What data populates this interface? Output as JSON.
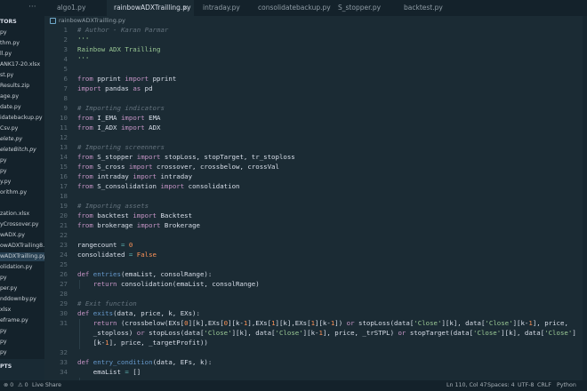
{
  "tabs": [
    {
      "label": "algo1.py",
      "active": false
    },
    {
      "label": "rainbowADXTrailling.py",
      "active": true
    },
    {
      "label": "intraday.py",
      "active": false
    },
    {
      "label": "consolidatebackup.py",
      "active": false
    },
    {
      "label": "S_stopper.py",
      "active": false
    },
    {
      "label": "backtest.py",
      "active": false
    }
  ],
  "tab_overflow": "···",
  "close_glyph": "×",
  "sidebar": {
    "section_title": "TORS",
    "files": [
      {
        "label": "py",
        "style": ""
      },
      {
        "label": "thm.py",
        "style": ""
      },
      {
        "label": "ll.py",
        "style": ""
      },
      {
        "label": "ANK17-20.xlsx",
        "style": ""
      },
      {
        "label": "st.py",
        "style": ""
      },
      {
        "label": "Results.zip",
        "style": ""
      },
      {
        "label": "age.py",
        "style": ""
      },
      {
        "label": "date.py",
        "style": ""
      },
      {
        "label": "idatebackup.py",
        "style": ""
      },
      {
        "label": "Csv.py",
        "style": ""
      },
      {
        "label": "elete.py",
        "style": "ital"
      },
      {
        "label": "eleteBitch.py",
        "style": "ital"
      },
      {
        "label": "py",
        "style": ""
      },
      {
        "label": "py",
        "style": ""
      },
      {
        "label": "y.py",
        "style": ""
      },
      {
        "label": "orithm.py",
        "style": ""
      },
      {
        "label": "",
        "style": ""
      },
      {
        "label": "zation.xlsx",
        "style": ""
      },
      {
        "label": "yCrossover.py",
        "style": ""
      },
      {
        "label": "wADX.py",
        "style": ""
      },
      {
        "label": "owADXTrailing8...",
        "style": ""
      },
      {
        "label": "wADXTrailling.py",
        "style": "sel"
      },
      {
        "label": "olidation.py",
        "style": ""
      },
      {
        "label": "py",
        "style": ""
      },
      {
        "label": "per.py",
        "style": ""
      },
      {
        "label": "nddownby.py",
        "style": ""
      },
      {
        "label": "xlsx",
        "style": ""
      },
      {
        "label": "eframe.py",
        "style": ""
      },
      {
        "label": "py",
        "style": ""
      },
      {
        "label": "py",
        "style": ""
      },
      {
        "label": "py",
        "style": ""
      }
    ],
    "footer_title": "PTS"
  },
  "editor": {
    "breadcrumb": "rainbowADXTrailling.py",
    "lines": [
      {
        "n": "1",
        "tokens": [
          [
            "c-cmt",
            "# Author - Karan Parmar"
          ]
        ]
      },
      {
        "n": "2",
        "tokens": [
          [
            "c-str",
            "'''"
          ]
        ]
      },
      {
        "n": "3",
        "tokens": [
          [
            "c-str",
            "Rainbow ADX Trailling"
          ]
        ]
      },
      {
        "n": "4",
        "tokens": [
          [
            "c-str",
            "'''"
          ]
        ]
      },
      {
        "n": "5",
        "tokens": []
      },
      {
        "n": "6",
        "tokens": [
          [
            "c-kw",
            "from"
          ],
          [
            "c-id",
            " pprint "
          ],
          [
            "c-kw",
            "import"
          ],
          [
            "c-id",
            " pprint"
          ]
        ]
      },
      {
        "n": "7",
        "tokens": [
          [
            "c-kw",
            "import"
          ],
          [
            "c-id",
            " pandas "
          ],
          [
            "c-kw",
            "as"
          ],
          [
            "c-id",
            " pd"
          ]
        ]
      },
      {
        "n": "8",
        "tokens": []
      },
      {
        "n": "9",
        "tokens": [
          [
            "c-cmt",
            "# Importing indicators"
          ]
        ]
      },
      {
        "n": "10",
        "tokens": [
          [
            "c-kw",
            "from"
          ],
          [
            "c-id",
            " I_EMA "
          ],
          [
            "c-kw",
            "import"
          ],
          [
            "c-id",
            " EMA"
          ]
        ]
      },
      {
        "n": "11",
        "tokens": [
          [
            "c-kw",
            "from"
          ],
          [
            "c-id",
            " I_ADX "
          ],
          [
            "c-kw",
            "import"
          ],
          [
            "c-id",
            " ADX"
          ]
        ]
      },
      {
        "n": "12",
        "tokens": []
      },
      {
        "n": "13",
        "tokens": [
          [
            "c-cmt",
            "# Importing screenners"
          ]
        ]
      },
      {
        "n": "14",
        "tokens": [
          [
            "c-kw",
            "from"
          ],
          [
            "c-id",
            " S_stopper "
          ],
          [
            "c-kw",
            "import"
          ],
          [
            "c-id",
            " stopLoss, stopTarget, tr_stoploss"
          ]
        ]
      },
      {
        "n": "15",
        "tokens": [
          [
            "c-kw",
            "from"
          ],
          [
            "c-id",
            " S_cross "
          ],
          [
            "c-kw",
            "import"
          ],
          [
            "c-id",
            " crossover, crossbelow, crossVal"
          ]
        ]
      },
      {
        "n": "16",
        "tokens": [
          [
            "c-kw",
            "from"
          ],
          [
            "c-id",
            " intraday "
          ],
          [
            "c-kw",
            "import"
          ],
          [
            "c-id",
            " intraday"
          ]
        ]
      },
      {
        "n": "17",
        "tokens": [
          [
            "c-kw",
            "from"
          ],
          [
            "c-id",
            " S_consolidation "
          ],
          [
            "c-kw",
            "import"
          ],
          [
            "c-id",
            " consolidation"
          ]
        ]
      },
      {
        "n": "18",
        "tokens": []
      },
      {
        "n": "19",
        "tokens": [
          [
            "c-cmt",
            "# Importing assets"
          ]
        ]
      },
      {
        "n": "20",
        "tokens": [
          [
            "c-kw",
            "from"
          ],
          [
            "c-id",
            " backtest "
          ],
          [
            "c-kw",
            "import"
          ],
          [
            "c-id",
            " Backtest"
          ]
        ]
      },
      {
        "n": "21",
        "tokens": [
          [
            "c-kw",
            "from"
          ],
          [
            "c-id",
            " brokerage "
          ],
          [
            "c-kw",
            "import"
          ],
          [
            "c-id",
            " Brokerage"
          ]
        ]
      },
      {
        "n": "22",
        "tokens": []
      },
      {
        "n": "23",
        "tokens": [
          [
            "c-id",
            "rangecount "
          ],
          [
            "c-op",
            "="
          ],
          [
            "c-num",
            " 0"
          ]
        ]
      },
      {
        "n": "24",
        "tokens": [
          [
            "c-id",
            "consolidated "
          ],
          [
            "c-op",
            "="
          ],
          [
            "c-num",
            " False"
          ]
        ]
      },
      {
        "n": "25",
        "tokens": []
      },
      {
        "n": "26",
        "tokens": [
          [
            "c-kw",
            "def"
          ],
          [
            "c-fn",
            " entries"
          ],
          [
            "c-id",
            "(emaList, consolRange):"
          ]
        ]
      },
      {
        "n": "27",
        "tokens": [
          [
            "c-kw",
            "    return"
          ],
          [
            "c-id",
            " consolidation(emaList, consolRange)"
          ]
        ]
      },
      {
        "n": "28",
        "tokens": []
      },
      {
        "n": "29",
        "tokens": [
          [
            "c-cmt",
            "# Exit function"
          ]
        ]
      },
      {
        "n": "30",
        "tokens": [
          [
            "c-kw",
            "def"
          ],
          [
            "c-fn",
            " exits"
          ],
          [
            "c-id",
            "(data, price, k, EXs):"
          ]
        ]
      },
      {
        "n": "31",
        "tokens": [
          [
            "c-kw",
            "    return"
          ],
          [
            "c-id",
            " (crossbelow(EXs["
          ],
          [
            "c-num",
            "0"
          ],
          [
            "c-id",
            "][k],EXs["
          ],
          [
            "c-num",
            "0"
          ],
          [
            "c-id",
            "][k-"
          ],
          [
            "c-num",
            "1"
          ],
          [
            "c-id",
            "],EXs["
          ],
          [
            "c-num",
            "1"
          ],
          [
            "c-id",
            "][k],EXs["
          ],
          [
            "c-num",
            "1"
          ],
          [
            "c-id",
            "][k-"
          ],
          [
            "c-num",
            "1"
          ],
          [
            "c-id",
            "]) "
          ],
          [
            "c-kw",
            "or"
          ],
          [
            "c-id",
            " stopLoss(data["
          ],
          [
            "c-str",
            "'Close'"
          ],
          [
            "c-id",
            "][k], data["
          ],
          [
            "c-str",
            "'Close'"
          ],
          [
            "c-id",
            "][k-"
          ],
          [
            "c-num",
            "1"
          ],
          [
            "c-id",
            "], price,"
          ]
        ]
      },
      {
        "n": "",
        "tokens": [
          [
            "c-id",
            "    _stoploss) "
          ],
          [
            "c-kw",
            "or"
          ],
          [
            "c-id",
            " stopLoss(data["
          ],
          [
            "c-str",
            "'Close'"
          ],
          [
            "c-id",
            "][k], data["
          ],
          [
            "c-str",
            "'Close'"
          ],
          [
            "c-id",
            "][k-"
          ],
          [
            "c-num",
            "1"
          ],
          [
            "c-id",
            "], price, _trSTPL) "
          ],
          [
            "c-kw",
            "or"
          ],
          [
            "c-id",
            " stopTarget(data["
          ],
          [
            "c-str",
            "'Close'"
          ],
          [
            "c-id",
            "][k], data["
          ],
          [
            "c-str",
            "'Close'"
          ],
          [
            "c-id",
            "]"
          ]
        ]
      },
      {
        "n": "",
        "tokens": [
          [
            "c-id",
            "    [k-"
          ],
          [
            "c-num",
            "1"
          ],
          [
            "c-id",
            "], price, _targetProfit))"
          ]
        ]
      },
      {
        "n": "32",
        "tokens": []
      },
      {
        "n": "33",
        "tokens": [
          [
            "c-kw",
            "def"
          ],
          [
            "c-fn",
            " entry_condition"
          ],
          [
            "c-id",
            "(data, EFs, k):"
          ]
        ]
      },
      {
        "n": "34",
        "tokens": [
          [
            "c-id",
            "    emaList "
          ],
          [
            "c-op",
            "="
          ],
          [
            "c-id",
            " []"
          ]
        ]
      }
    ]
  },
  "status": {
    "errors": "⊗ 0",
    "warnings": "⚠ 0",
    "live_share": "Live Share",
    "position": "Ln 110, Col 47",
    "spaces": "Spaces: 4",
    "encoding": "UTF-8",
    "eol": "CRLF",
    "language": "Python"
  }
}
